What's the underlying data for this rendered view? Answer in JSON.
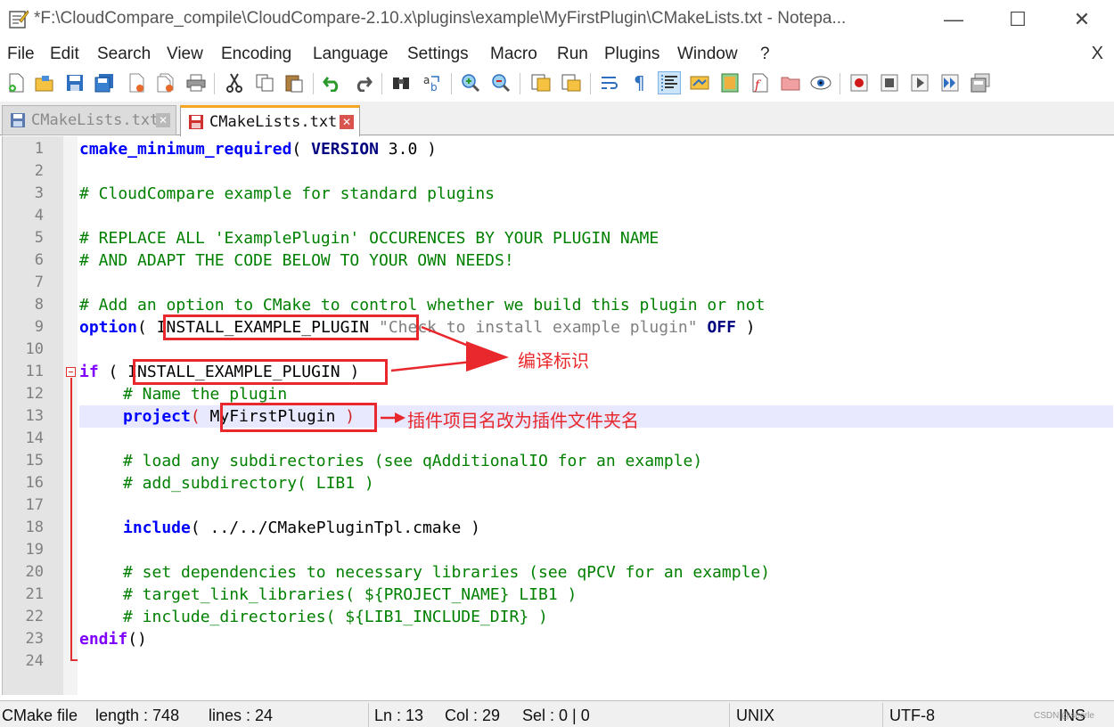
{
  "window": {
    "title": "*F:\\CloudCompare_compile\\CloudCompare-2.10.x\\plugins\\example\\MyFirstPlugin\\CMakeLists.txt - Notepa...",
    "minimize_glyph": "—",
    "maximize_glyph": "☐",
    "close_glyph": "✕"
  },
  "menu": {
    "items": [
      "File",
      "Edit",
      "Search",
      "View",
      "Encoding",
      "Language",
      "Settings",
      "Macro",
      "Run",
      "Plugins",
      "Window",
      "?"
    ],
    "close_glyph": "X"
  },
  "toolbar": {
    "icons": [
      "new-file-icon",
      "open-file-icon",
      "save-icon",
      "save-all-icon",
      "close-icon",
      "close-all-icon",
      "print-icon",
      "cut-icon",
      "copy-icon",
      "paste-icon",
      "undo-icon",
      "redo-icon",
      "find-icon",
      "replace-icon",
      "zoom-in-icon",
      "zoom-out-icon",
      "sync-vertical-icon",
      "sync-horizontal-icon",
      "word-wrap-icon",
      "show-all-chars-icon",
      "indent-guide-icon",
      "udl-icon",
      "doc-map-icon",
      "function-list-icon",
      "folder-workspace-icon",
      "monitoring-icon",
      "record-macro-icon",
      "stop-macro-icon",
      "play-macro-icon",
      "run-macro-multiple-icon",
      "save-macro-icon"
    ]
  },
  "tabs": [
    {
      "label": "CMakeLists.txt",
      "close": "✕",
      "active": false
    },
    {
      "label": "CMakeLists.txt",
      "close": "✕",
      "active": true
    }
  ],
  "editor": {
    "current_line": 13,
    "lines": [
      {
        "n": "1"
      },
      {
        "n": "2"
      },
      {
        "n": "3"
      },
      {
        "n": "4"
      },
      {
        "n": "5"
      },
      {
        "n": "6"
      },
      {
        "n": "7"
      },
      {
        "n": "8"
      },
      {
        "n": "9"
      },
      {
        "n": "10"
      },
      {
        "n": "11"
      },
      {
        "n": "12"
      },
      {
        "n": "13"
      },
      {
        "n": "14"
      },
      {
        "n": "15"
      },
      {
        "n": "16"
      },
      {
        "n": "17"
      },
      {
        "n": "18"
      },
      {
        "n": "19"
      },
      {
        "n": "20"
      },
      {
        "n": "21"
      },
      {
        "n": "22"
      },
      {
        "n": "23"
      },
      {
        "n": "24"
      }
    ],
    "code": {
      "l1_kw": "cmake_minimum_required",
      "l1_a": "( ",
      "l1_kw2": "VERSION",
      "l1_b": " 3.0 )",
      "l3": "# CloudCompare example for standard plugins",
      "l5": "# REPLACE ALL 'ExamplePlugin' OCCURENCES BY YOUR PLUGIN NAME",
      "l6": "# AND ADAPT THE CODE BELOW TO YOUR OWN NEEDS!",
      "l8": "# Add an option to CMake to control whether we build this plugin or not",
      "l9_kw": "option",
      "l9_a": "( ",
      "l9_var": "INSTALL_EXAMPLE_PLUGIN",
      "l9_b": " ",
      "l9_str": "\"Check to install example plugin\"",
      "l9_c": " ",
      "l9_kw2": "OFF",
      "l9_d": " )",
      "l11_kw": "if",
      "l11_a": " ( ",
      "l11_var": "INSTALL_EXAMPLE_PLUGIN",
      "l11_b": " )",
      "l12": "# Name the plugin",
      "l13_kw": "project",
      "l13_a": "( ",
      "l13_var": "MyFirstPlugin",
      "l13_b": " )",
      "l15": "# load any subdirectories (see qAdditionalIO for an example)",
      "l16": "# add_subdirectory( LIB1 )",
      "l18_kw": "include",
      "l18_a": "( ../../CMakePluginTpl.cmake )",
      "l20": "# set dependencies to necessary libraries (see qPCV for an example)",
      "l21": "# target_link_libraries( ${PROJECT_NAME} LIB1 )",
      "l22": "# include_directories( ${LIB1_INCLUDE_DIR} )",
      "l23_kw": "endif",
      "l23_a": "()"
    }
  },
  "annotations": {
    "compile_flag": "编译标识",
    "rename_project": "插件项目名改为插件文件夹名"
  },
  "status": {
    "language": "CMake file",
    "length": "length : 748",
    "lines": "lines : 24",
    "ln": "Ln : 13",
    "col": "Col : 29",
    "sel": "Sel : 0 | 0",
    "eol": "UNIX",
    "encoding": "UTF-8",
    "mode": "INS",
    "watermark": "CSDN @secrle"
  },
  "colors": {
    "keyword": "#0000ff",
    "keyword2": "#8000ff",
    "comment": "#008000",
    "string": "#808080",
    "annotation_red": "#e8282c",
    "current_line_bg": "#e8e8ff"
  }
}
